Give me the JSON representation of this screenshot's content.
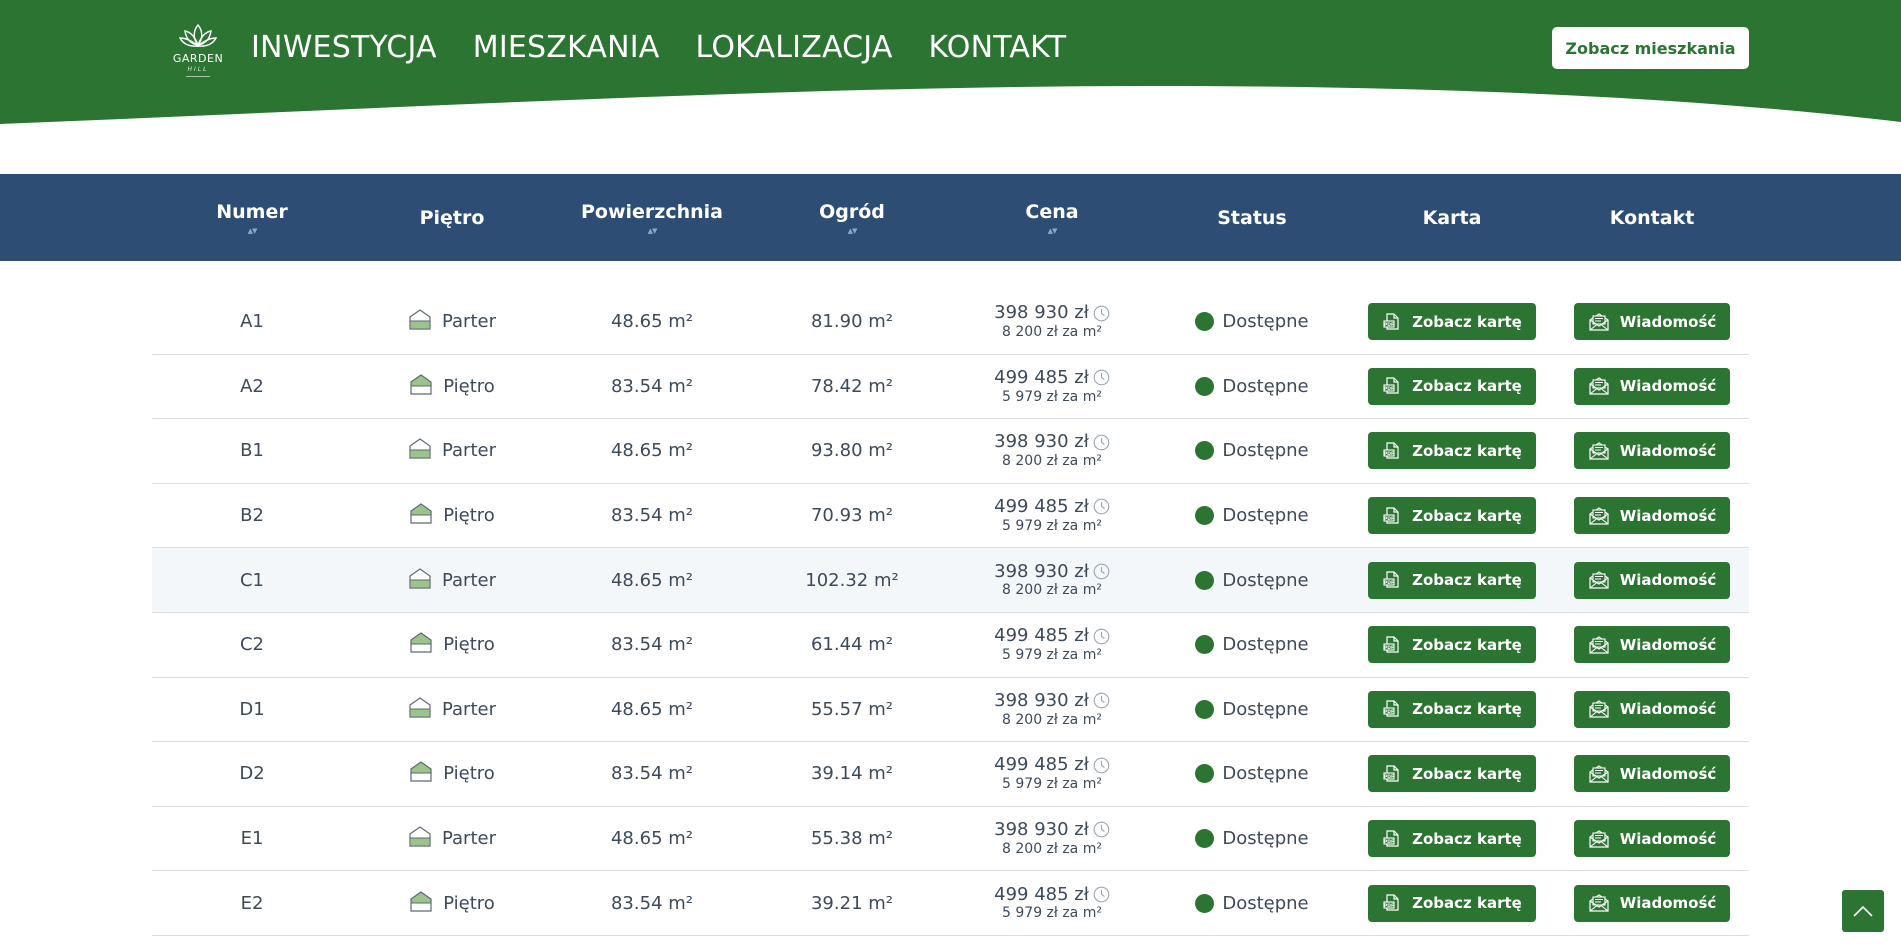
{
  "header": {
    "logo_name": "GARDEN",
    "logo_sub": "HILL",
    "nav": [
      "INWESTYCJA",
      "MIESZKANIA",
      "LOKALIZACJA",
      "KONTAKT"
    ],
    "cta_label": "Zobacz mieszkania"
  },
  "table": {
    "columns": [
      "Numer",
      "Piętro",
      "Powierzchnia",
      "Ogród",
      "Cena",
      "Status",
      "Karta",
      "Kontakt"
    ],
    "sort_glyph": "▲▼",
    "card_label": "Zobacz kartę",
    "message_label": "Wiadomość",
    "rows": [
      {
        "numer": "A1",
        "pietro": "Parter",
        "powierzchnia": "48.65 m²",
        "ogrod": "81.90 m²",
        "cena": "398 930 zł",
        "cena_m2": "8 200 zł za m²",
        "status": "Dostępne"
      },
      {
        "numer": "A2",
        "pietro": "Piętro",
        "powierzchnia": "83.54 m²",
        "ogrod": "78.42 m²",
        "cena": "499 485 zł",
        "cena_m2": "5 979 zł za m²",
        "status": "Dostępne"
      },
      {
        "numer": "B1",
        "pietro": "Parter",
        "powierzchnia": "48.65 m²",
        "ogrod": "93.80 m²",
        "cena": "398 930 zł",
        "cena_m2": "8 200 zł za m²",
        "status": "Dostępne"
      },
      {
        "numer": "B2",
        "pietro": "Piętro",
        "powierzchnia": "83.54 m²",
        "ogrod": "70.93 m²",
        "cena": "499 485 zł",
        "cena_m2": "5 979 zł za m²",
        "status": "Dostępne"
      },
      {
        "numer": "C1",
        "pietro": "Parter",
        "powierzchnia": "48.65 m²",
        "ogrod": "102.32 m²",
        "cena": "398 930 zł",
        "cena_m2": "8 200 zł za m²",
        "status": "Dostępne"
      },
      {
        "numer": "C2",
        "pietro": "Piętro",
        "powierzchnia": "83.54 m²",
        "ogrod": "61.44 m²",
        "cena": "499 485 zł",
        "cena_m2": "5 979 zł za m²",
        "status": "Dostępne"
      },
      {
        "numer": "D1",
        "pietro": "Parter",
        "powierzchnia": "48.65 m²",
        "ogrod": "55.57 m²",
        "cena": "398 930 zł",
        "cena_m2": "8 200 zł za m²",
        "status": "Dostępne"
      },
      {
        "numer": "D2",
        "pietro": "Piętro",
        "powierzchnia": "83.54 m²",
        "ogrod": "39.14 m²",
        "cena": "499 485 zł",
        "cena_m2": "5 979 zł za m²",
        "status": "Dostępne"
      },
      {
        "numer": "E1",
        "pietro": "Parter",
        "powierzchnia": "48.65 m²",
        "ogrod": "55.38 m²",
        "cena": "398 930 zł",
        "cena_m2": "8 200 zł za m²",
        "status": "Dostępne"
      },
      {
        "numer": "E2",
        "pietro": "Piętro",
        "powierzchnia": "83.54 m²",
        "ogrod": "39.21 m²",
        "cena": "499 485 zł",
        "cena_m2": "5 979 zł za m²",
        "status": "Dostępne"
      }
    ]
  },
  "colors": {
    "brand_green": "#2c7432",
    "table_header_blue": "#2d4d74",
    "status_available": "#2c7432"
  },
  "icons": {
    "floor_ground": "house-ground-floor-icon",
    "floor_upper": "house-upper-floor-icon",
    "price_history": "clock-icon",
    "card": "pdf-document-icon",
    "message": "envelope-icon",
    "scroll_top": "chevron-up-icon"
  }
}
